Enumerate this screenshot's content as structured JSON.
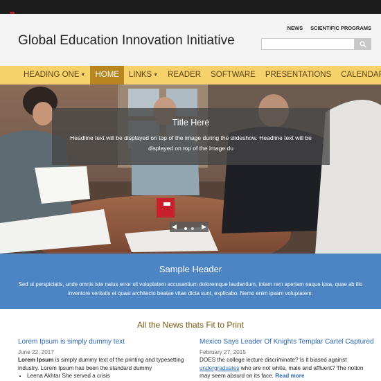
{
  "header": {
    "site_title": "Global Education Innovation Initiative",
    "utility_links": [
      "NEWS",
      "SCIENTIFIC PROGRAMS"
    ],
    "search": {
      "placeholder": "",
      "value": ""
    }
  },
  "nav": {
    "items": [
      {
        "label": "HEADING ONE",
        "has_dropdown": true,
        "active": false
      },
      {
        "label": "HOME",
        "has_dropdown": false,
        "active": true
      },
      {
        "label": "LINKS",
        "has_dropdown": true,
        "active": false
      },
      {
        "label": "READER",
        "has_dropdown": false,
        "active": false
      },
      {
        "label": "SOFTWARE",
        "has_dropdown": false,
        "active": false
      },
      {
        "label": "PRESENTATIONS",
        "has_dropdown": false,
        "active": false
      },
      {
        "label": "CALENDAR",
        "has_dropdown": false,
        "active": false
      }
    ]
  },
  "slideshow": {
    "caption_title": "Title Here",
    "caption_text": "Headline text will be displayed on top of the image during the slideshow. Headline text will be displayed on top of the image du",
    "slide_count": 2,
    "current_slide": 1
  },
  "banner": {
    "title": "Sample Header",
    "text": "Sed ut perspiciatis, unde omnis iste natus error sit voluptatem accusantium doloremque laudantium, totam rem aperiam eaque ipsa, quae ab illo inventore veritatis et quasi architecto beatae vitae dicta sunt, explicabo. Nemo enim ipsam voluptatem."
  },
  "news": {
    "heading": "All the News thats Fit to Print",
    "left": {
      "title": "Lorem Ipsum is simply dummy text",
      "date": "June 22, 2017",
      "body_bold": "Lorem Ipsum",
      "body_rest": " is simply dummy text of the printing and typesetting industry. Lorem Ipsum has been the standard dummy",
      "bullets": [
        "Leena Akhtar She served a crisis"
      ]
    },
    "right": {
      "title": "Mexico Says Leader Of Knights Templar Cartel Captured",
      "date": "February 27, 2015",
      "body_before_link": "DOES the college lecture discriminate? Is it biased against ",
      "link_text": "undergraduates",
      "body_after_link": " who are not white, male and affluent? The notion may seem absurd on its face.",
      "read_more": "Read more"
    }
  },
  "colors": {
    "nav_bg": "#f7d26a",
    "nav_active": "#b8861f",
    "banner_bg": "#4d84c4",
    "link": "#2c68b4",
    "news_heading": "#7a5a10"
  }
}
